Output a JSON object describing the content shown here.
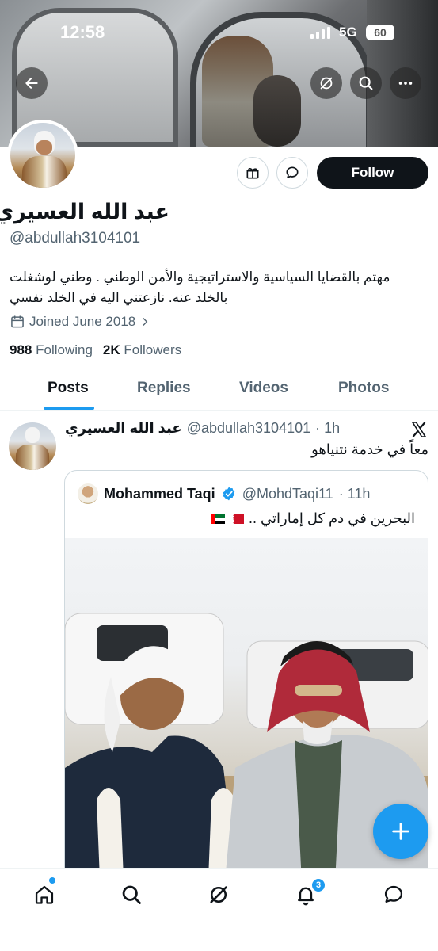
{
  "status_bar": {
    "time": "12:58",
    "network": "5G",
    "battery": "60"
  },
  "profile": {
    "name": "عبد الله العسيري",
    "handle": "@abdullah3104101",
    "bio": "مهتم بالقضايا السياسية والاستراتيجية والأمن الوطني . وطني لوشغلت بالخلد عنه. نازعتني اليه في الخلد نفسي",
    "joined": "Joined June 2018",
    "following_count": "988",
    "following_label": "Following",
    "followers_count": "2K",
    "followers_label": "Followers",
    "follow_label": "Follow"
  },
  "tabs": [
    {
      "label": "Posts"
    },
    {
      "label": "Replies"
    },
    {
      "label": "Videos"
    },
    {
      "label": "Photos"
    }
  ],
  "post": {
    "author_name": "عبد الله العسيري",
    "author_handle": "@abdullah3104101",
    "time": "· 1h",
    "text": "معاً في خدمة نتنياهو",
    "quote": {
      "author_name": "Mohammed Taqi",
      "author_handle": "@MohdTaqi11",
      "time": "· 11h",
      "text": "البحرين في دم كل إماراتي .."
    }
  },
  "nav": {
    "notification_count": "3"
  },
  "colors": {
    "accent": "#1d9bf0",
    "follow_bg": "#0f1419",
    "secondary_text": "#536471"
  }
}
